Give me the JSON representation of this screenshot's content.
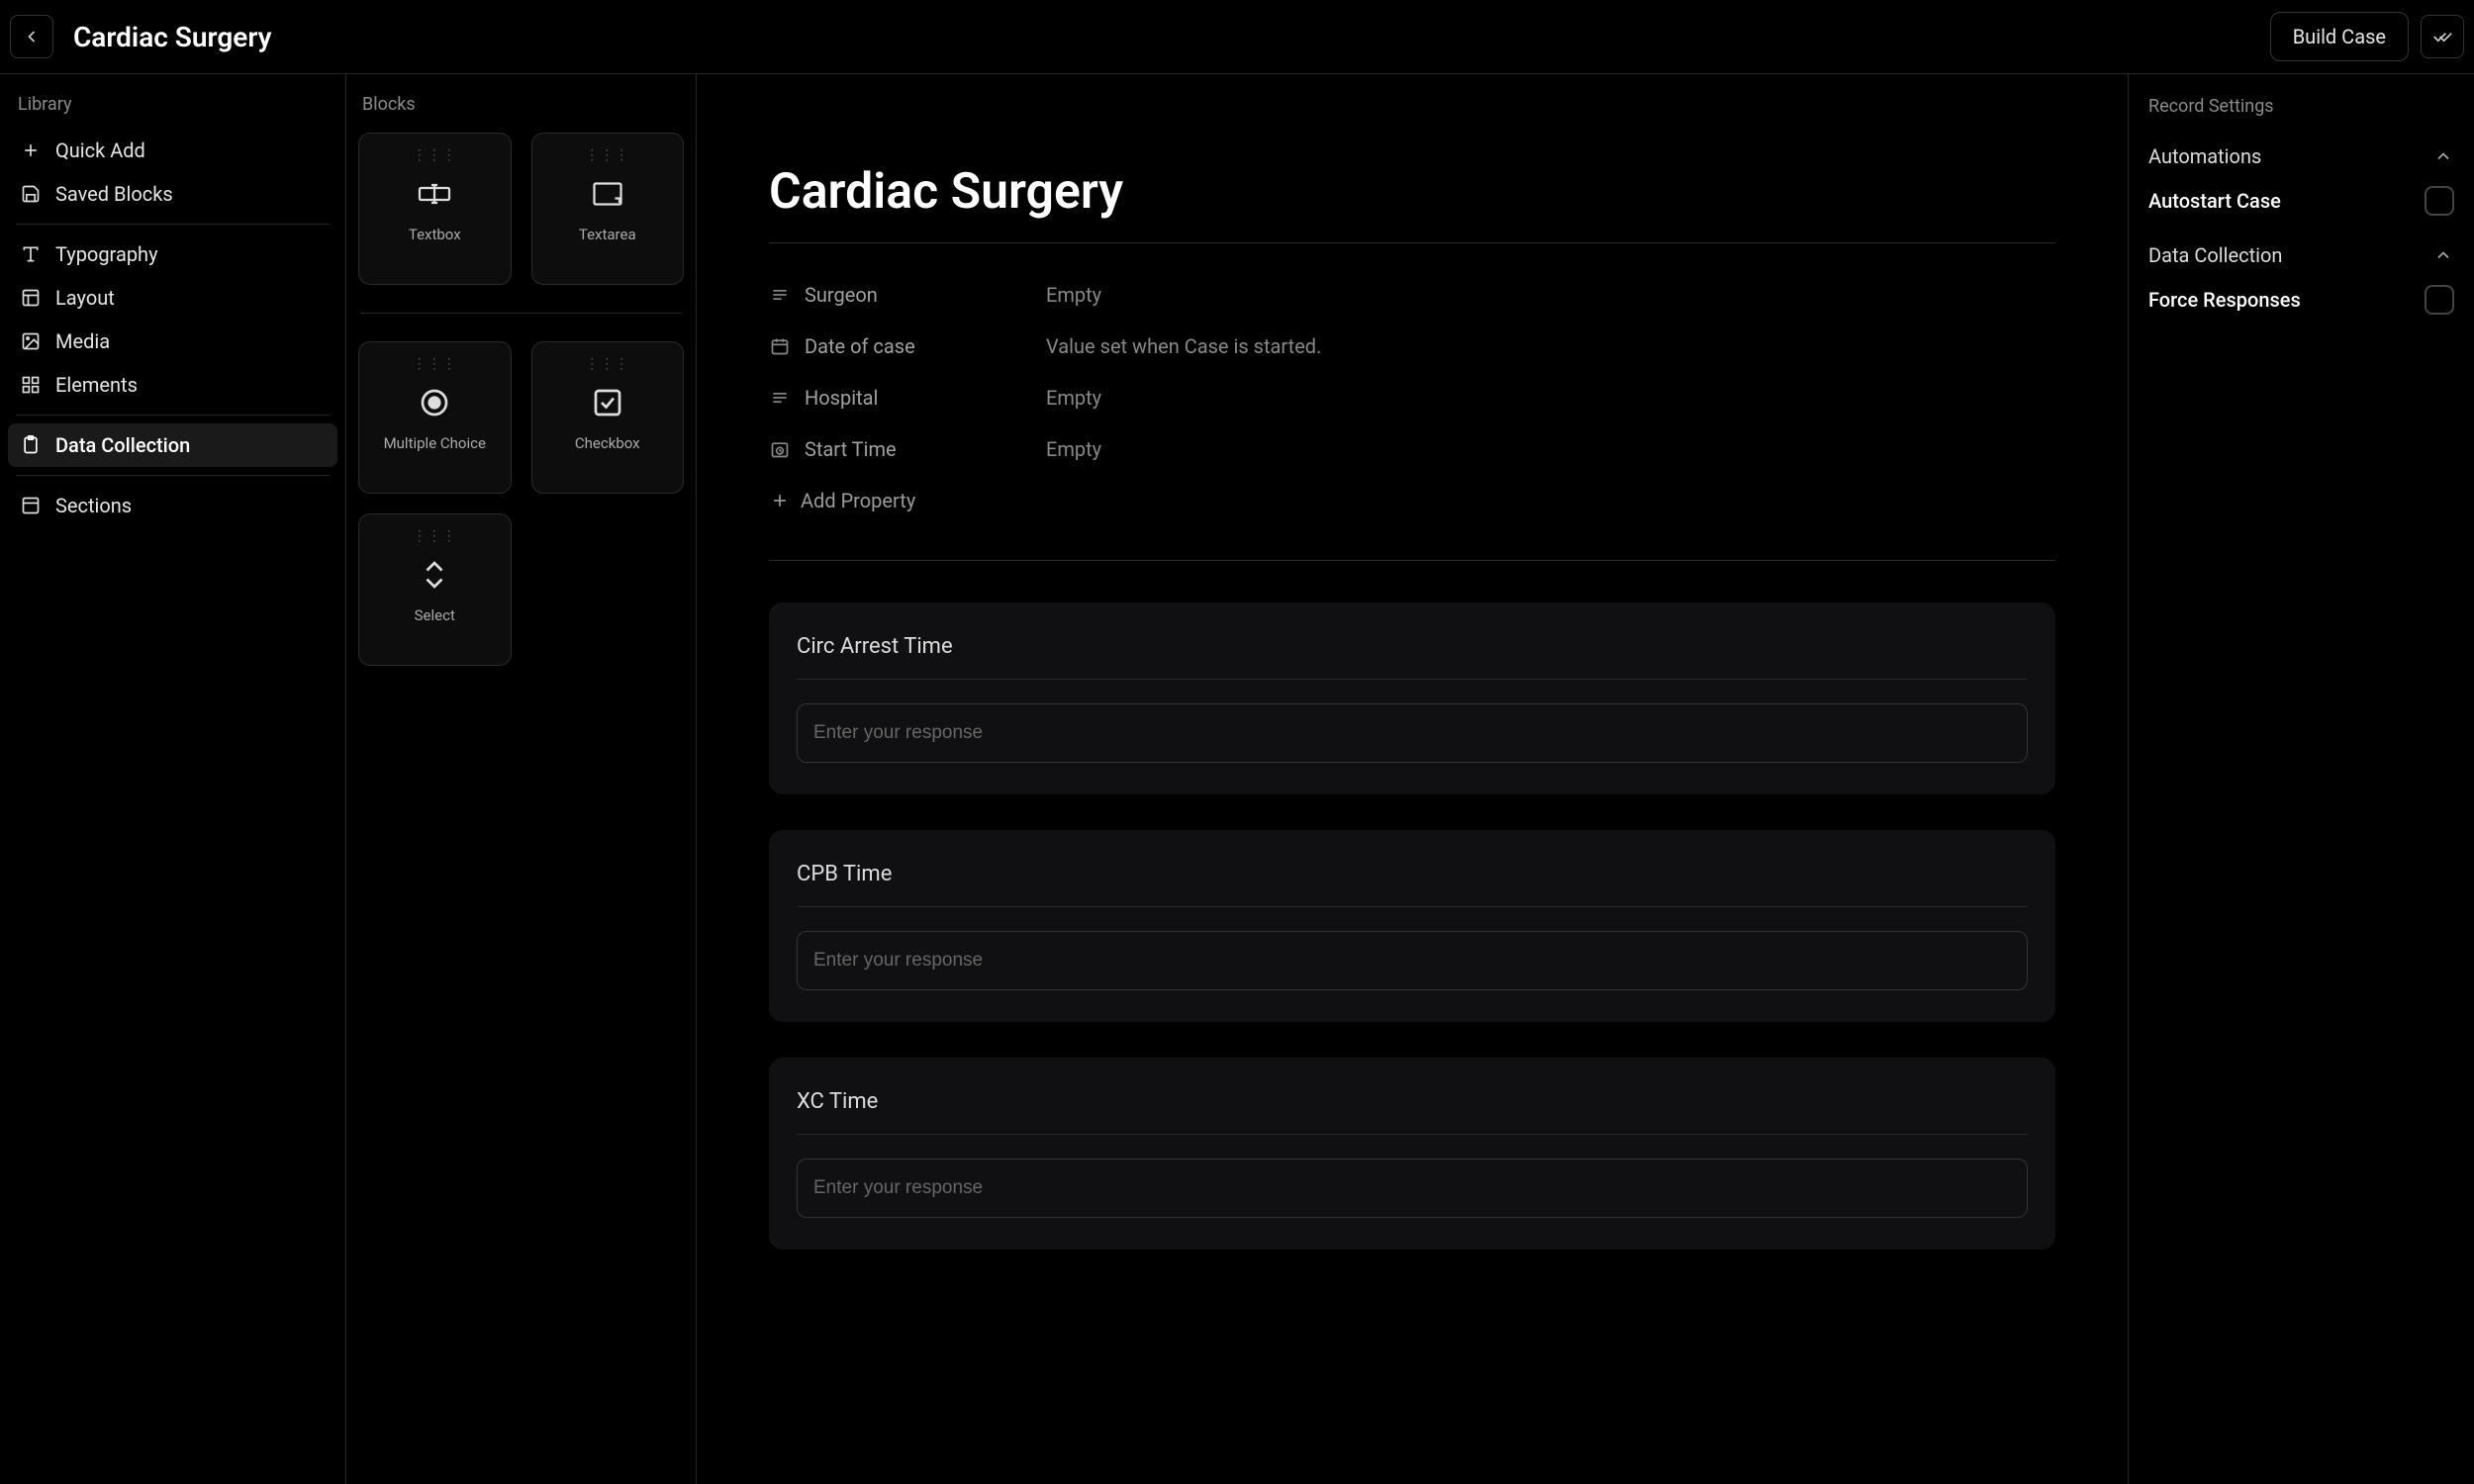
{
  "header": {
    "title": "Cardiac Surgery",
    "build_case": "Build Case"
  },
  "library": {
    "heading": "Library",
    "quick_add": "Quick Add",
    "saved_blocks": "Saved Blocks",
    "typography": "Typography",
    "layout": "Layout",
    "media": "Media",
    "elements": "Elements",
    "data_collection": "Data Collection",
    "sections": "Sections"
  },
  "blocks": {
    "heading": "Blocks",
    "textbox": "Textbox",
    "textarea": "Textarea",
    "multiple_choice": "Multiple Choice",
    "checkbox": "Checkbox",
    "select": "Select"
  },
  "canvas": {
    "title": "Cardiac Surgery",
    "properties": [
      {
        "label": "Surgeon",
        "value": "Empty",
        "icon": "text"
      },
      {
        "label": "Date of case",
        "value": "Value set when Case is started.",
        "icon": "calendar"
      },
      {
        "label": "Hospital",
        "value": "Empty",
        "icon": "text"
      },
      {
        "label": "Start Time",
        "value": "Empty",
        "icon": "clock"
      }
    ],
    "add_property": "Add Property",
    "cards": [
      {
        "title": "Circ Arrest Time",
        "placeholder": "Enter your response"
      },
      {
        "title": "CPB Time",
        "placeholder": "Enter your response"
      },
      {
        "title": "XC Time",
        "placeholder": "Enter your response"
      }
    ]
  },
  "settings": {
    "heading": "Record Settings",
    "automations": "Automations",
    "autostart": "Autostart Case",
    "data_collection": "Data Collection",
    "force_responses": "Force Responses"
  }
}
